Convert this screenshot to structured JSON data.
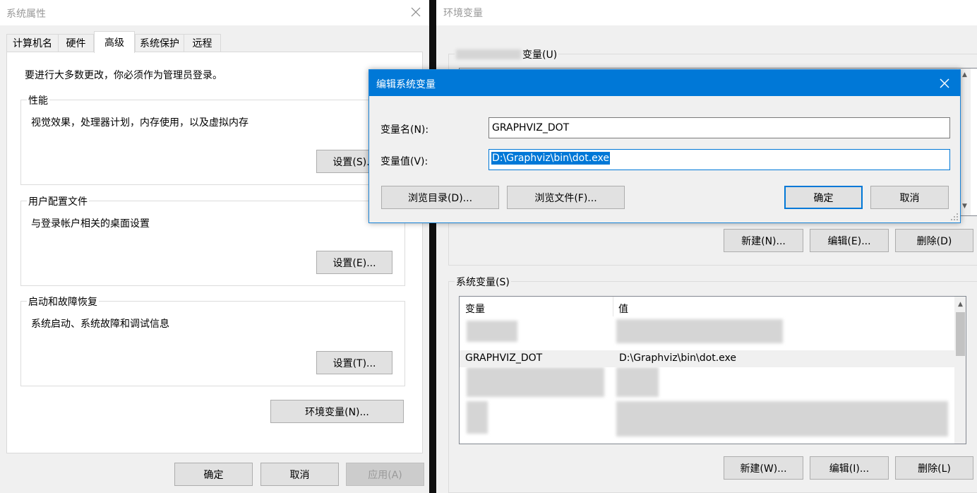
{
  "sys_props": {
    "title": "系统属性",
    "tabs": [
      "计算机名",
      "硬件",
      "高级",
      "系统保护",
      "远程"
    ],
    "admin_note": "要进行大多数更改，你必须作为管理员登录。",
    "perf": {
      "title": "性能",
      "desc": "视觉效果，处理器计划，内存使用，以及虚拟内存",
      "button": "设置(S)..."
    },
    "profile": {
      "title": "用户配置文件",
      "desc": "与登录帐户相关的桌面设置",
      "button": "设置(E)..."
    },
    "startup": {
      "title": "启动和故障恢复",
      "desc": "系统启动、系统故障和调试信息",
      "button": "设置(T)..."
    },
    "env_button": "环境变量(N)...",
    "ok": "确定",
    "cancel": "取消",
    "apply": "应用(A)"
  },
  "env_vars": {
    "title": "环境变量",
    "user_vars_label": "变量(U)",
    "user_buttons": {
      "new": "新建(N)...",
      "edit": "编辑(E)...",
      "delete": "删除(D)"
    },
    "sys_vars_label": "系统变量(S)",
    "columns": [
      "变量",
      "值"
    ],
    "rows": [
      {
        "name": "GRAPHVIZ_DOT",
        "value": "D:\\Graphviz\\bin\\dot.exe"
      }
    ],
    "sys_buttons": {
      "new": "新建(W)...",
      "edit": "编辑(I)...",
      "delete": "删除(L)"
    }
  },
  "edit_dialog": {
    "title": "编辑系统变量",
    "name_label": "变量名(N):",
    "name_value": "GRAPHVIZ_DOT",
    "value_label": "变量值(V):",
    "value_value": "D:\\Graphviz\\bin\\dot.exe",
    "browse_dir": "浏览目录(D)...",
    "browse_file": "浏览文件(F)...",
    "ok": "确定",
    "cancel": "取消"
  },
  "icons": [
    "close-icon",
    "scroll-up-icon",
    "scroll-down-icon",
    "resize-grip-icon"
  ],
  "colors": {
    "accent": "#0078d7",
    "selection": "#0078d7",
    "window": "#f0f0f0"
  }
}
